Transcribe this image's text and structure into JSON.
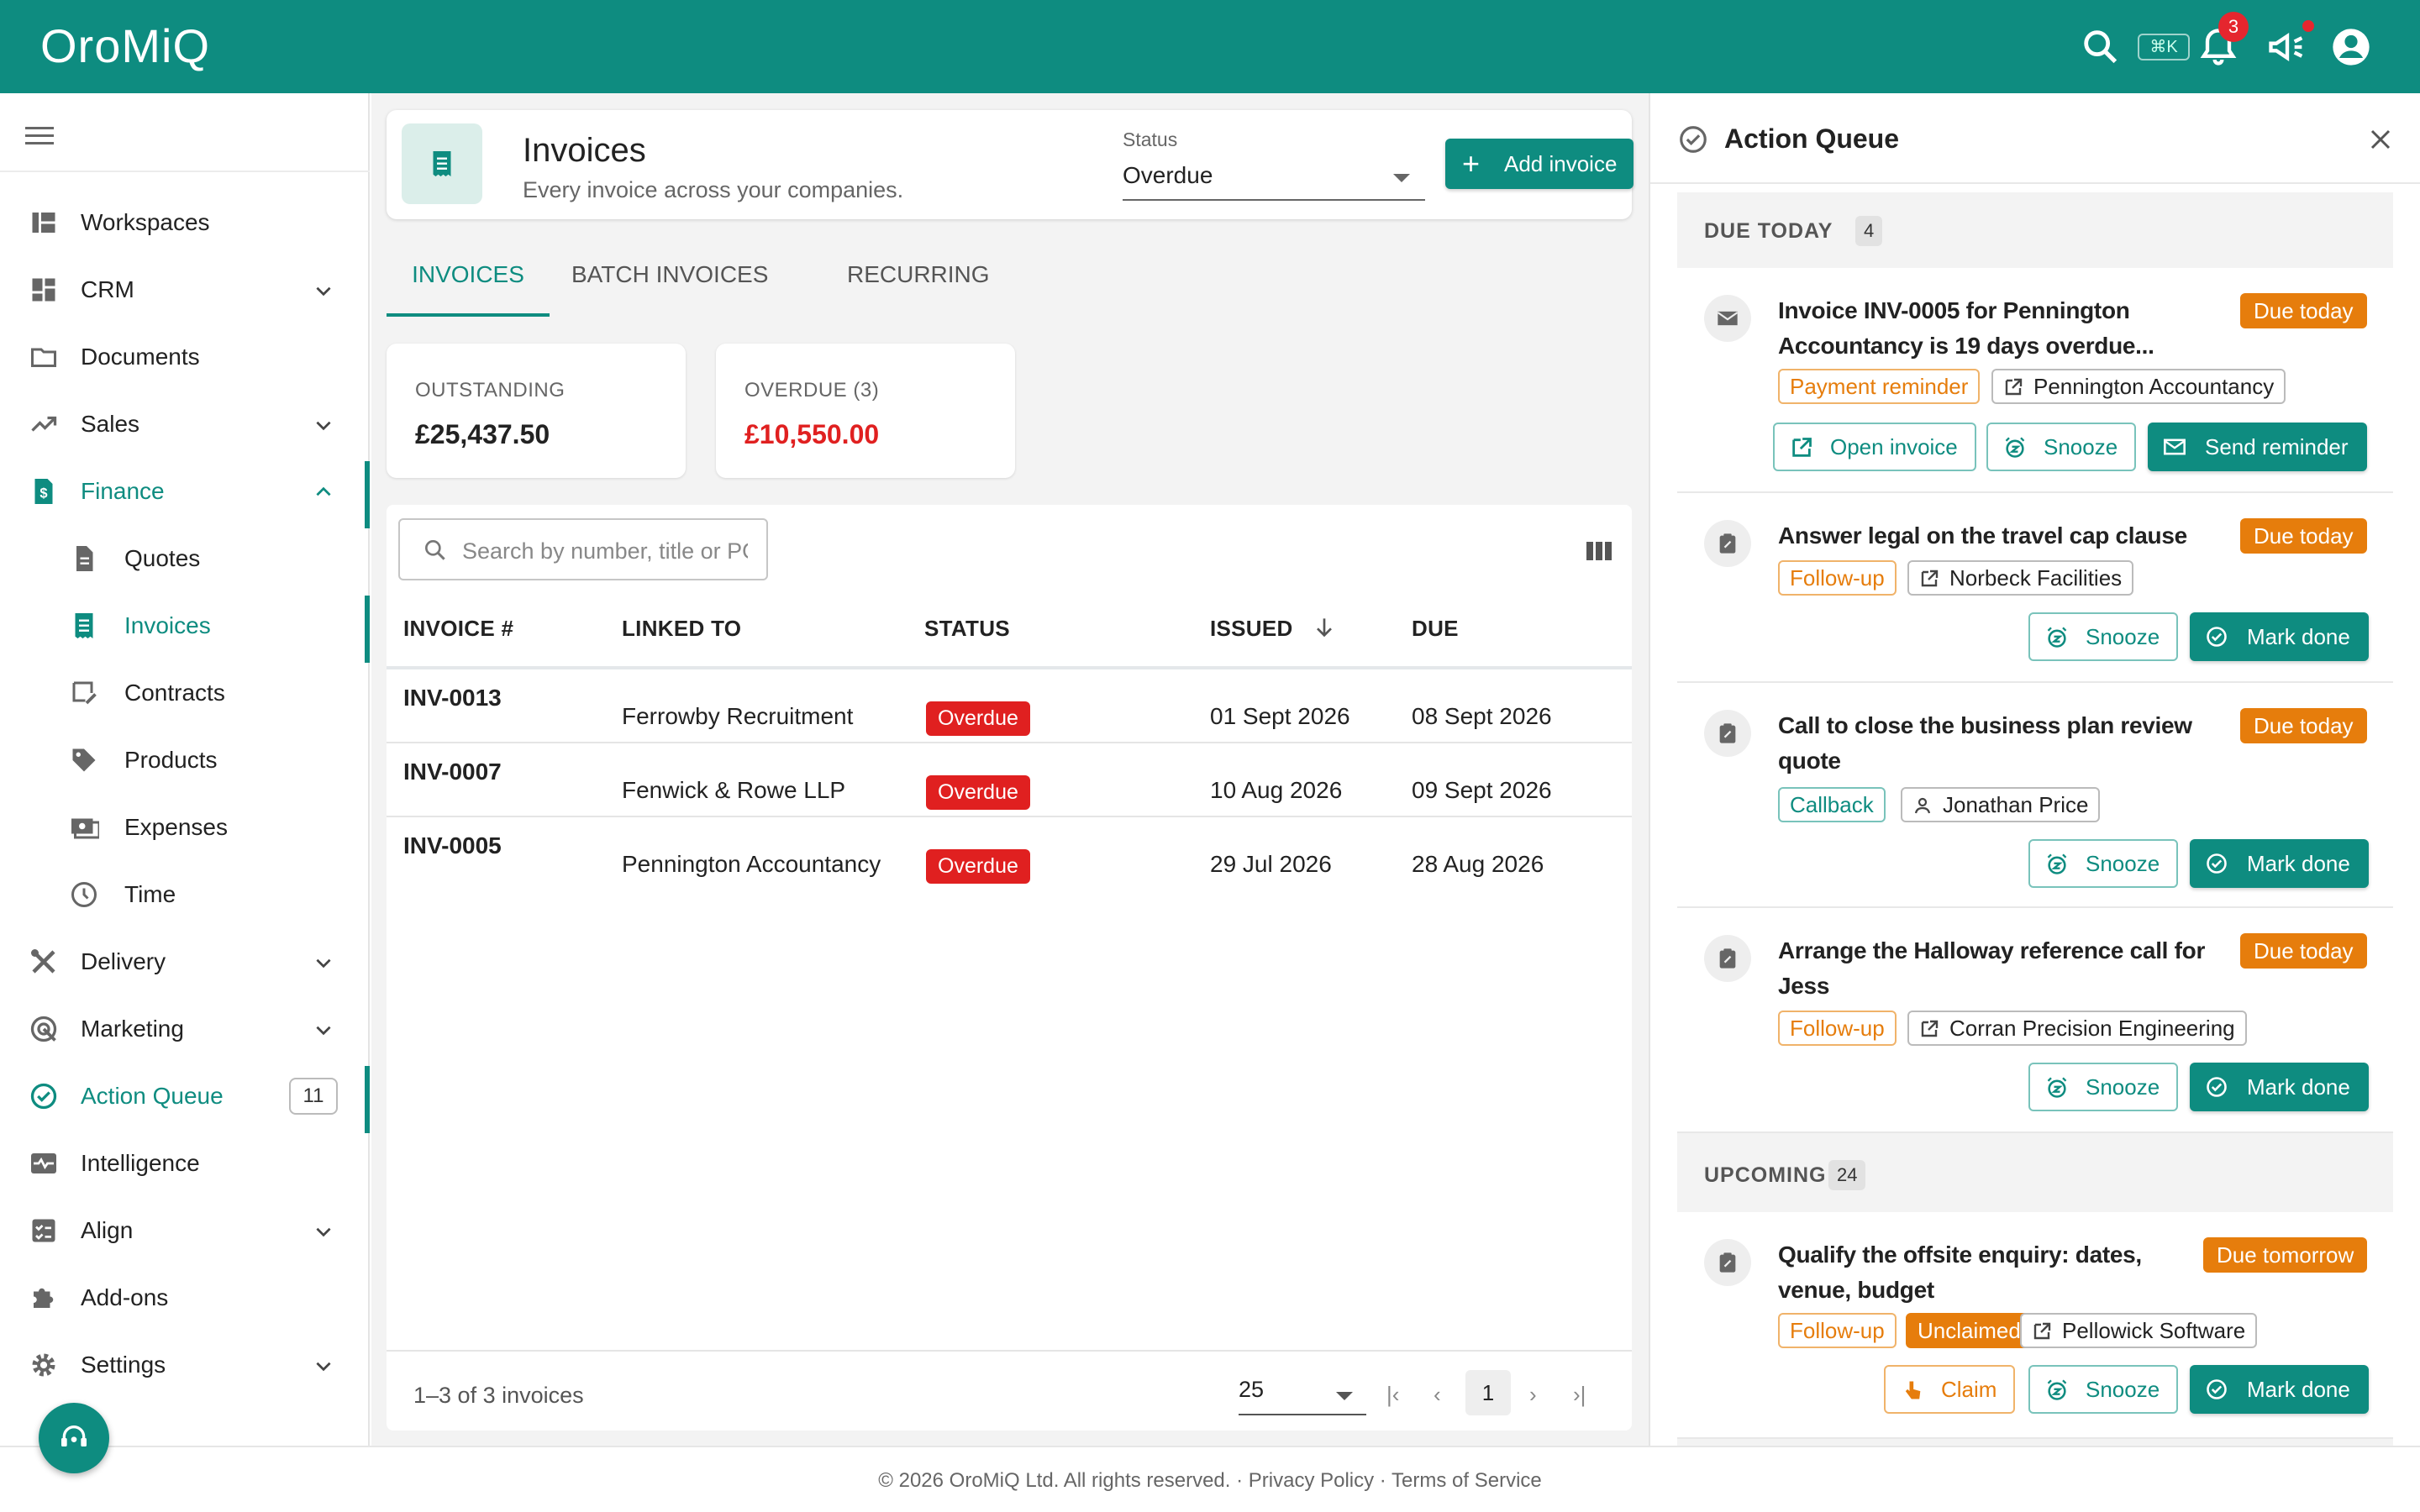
{
  "app": {
    "logo": "OroMiQ",
    "shortcut": "⌘K",
    "notifications_count": "3"
  },
  "sidebar": {
    "items": [
      {
        "label": "Workspaces",
        "icon": "workspaces-icon"
      },
      {
        "label": "CRM",
        "icon": "dashboard-icon"
      },
      {
        "label": "Documents",
        "icon": "folder-icon"
      },
      {
        "label": "Sales",
        "icon": "trending-up-icon"
      },
      {
        "label": "Finance",
        "icon": "finance-icon"
      },
      {
        "label": "Quotes",
        "icon": "document-icon"
      },
      {
        "label": "Invoices",
        "icon": "receipt-icon"
      },
      {
        "label": "Contracts",
        "icon": "contract-icon"
      },
      {
        "label": "Products",
        "icon": "tag-icon"
      },
      {
        "label": "Expenses",
        "icon": "expenses-icon"
      },
      {
        "label": "Time",
        "icon": "clock-icon"
      },
      {
        "label": "Delivery",
        "icon": "tools-icon"
      },
      {
        "label": "Marketing",
        "icon": "marketing-icon"
      },
      {
        "label": "Action Queue",
        "icon": "check-circle-icon",
        "count": "11"
      },
      {
        "label": "Intelligence",
        "icon": "monitor-heart-icon"
      },
      {
        "label": "Align",
        "icon": "checklist-icon"
      },
      {
        "label": "Add-ons",
        "icon": "puzzle-icon"
      },
      {
        "label": "Settings",
        "icon": "gear-icon"
      }
    ]
  },
  "header": {
    "title": "Invoices",
    "subtitle": "Every invoice across your companies.",
    "status_label": "Status",
    "status_value": "Overdue",
    "add_button": "Add invoice"
  },
  "tabs": [
    "INVOICES",
    "BATCH INVOICES",
    "RECURRING"
  ],
  "stats": {
    "outstanding_label": "OUTSTANDING",
    "outstanding_value": "£25,437.50",
    "overdue_label": "OVERDUE (3)",
    "overdue_value": "£10,550.00",
    "overdue_color": "#e02020"
  },
  "table": {
    "search_placeholder": "Search by number, title or PO",
    "headers": [
      "INVOICE #",
      "LINKED TO",
      "STATUS",
      "ISSUED",
      "DUE"
    ],
    "rows": [
      {
        "invoice": "INV-0013",
        "linked": "Ferrowby Recruitment",
        "status": "Overdue",
        "issued": "01 Sept 2026",
        "due": "08 Sept 2026"
      },
      {
        "invoice": "INV-0007",
        "linked": "Fenwick & Rowe LLP",
        "status": "Overdue",
        "issued": "10 Aug 2026",
        "due": "09 Sept 2026"
      },
      {
        "invoice": "INV-0005",
        "linked": "Pennington Accountancy",
        "status": "Overdue",
        "issued": "29 Jul 2026",
        "due": "28 Aug 2026"
      }
    ],
    "pagination_text": "1–3 of 3 invoices",
    "per_page": "25",
    "current_page": "1"
  },
  "action_queue": {
    "title": "Action Queue",
    "due_today_label": "DUE TODAY",
    "due_today_count": "4",
    "upcoming_label": "UPCOMING",
    "upcoming_count": "24",
    "items": [
      {
        "title": "Invoice INV-0005 for Pennington Accountancy is 19 days overdue...",
        "due": "Due today",
        "type": "Payment reminder",
        "entity": "Pennington Accountancy",
        "b1": "Open invoice",
        "b2": "Snooze",
        "b3": "Send reminder"
      },
      {
        "title": "Answer legal on the travel cap clause",
        "due": "Due today",
        "type": "Follow-up",
        "entity": "Norbeck Facilities",
        "b2": "Snooze",
        "b3": "Mark done"
      },
      {
        "title": "Call to close the business plan review quote",
        "due": "Due today",
        "type": "Callback",
        "entity": "Jonathan Price",
        "b2": "Snooze",
        "b3": "Mark done"
      },
      {
        "title": "Arrange the Halloway reference call for Jess",
        "due": "Due today",
        "type": "Follow-up",
        "entity": "Corran Precision Engineering",
        "b2": "Snooze",
        "b3": "Mark done"
      },
      {
        "title": "Qualify the offsite enquiry: dates, venue, budget",
        "due": "Due tomorrow",
        "type": "Follow-up",
        "extra": "Unclaimed",
        "entity": "Pellowick Software",
        "b1": "Claim",
        "b2": "Snooze",
        "b3": "Mark done"
      }
    ]
  },
  "footer": {
    "text": "© 2026 OroMiQ Ltd. All rights reserved.   ·   Privacy Policy  ·  Terms of Service"
  },
  "colors": {
    "brand": "#0e8c80",
    "danger": "#e02020",
    "warning": "#e67d0c"
  }
}
